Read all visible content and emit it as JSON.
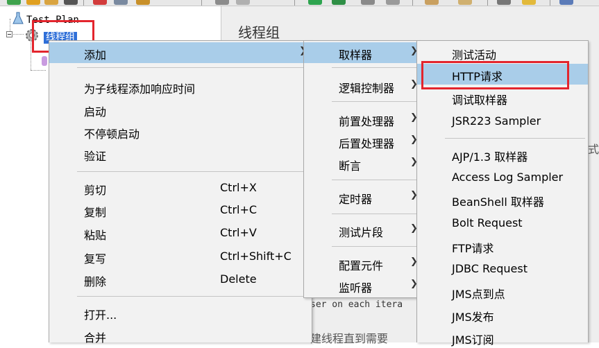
{
  "tree": {
    "root_label": "Test Plan",
    "thread_group_label": "线程组"
  },
  "right_panel": {
    "title": "线程组",
    "fragment_1": "ser on each itera",
    "fragment_2": "建线程直到需要",
    "fragment_3": "式"
  },
  "context_menu": {
    "add": "添加",
    "add_response_time": "为子线程添加响应时间",
    "start": "启动",
    "start_no_pause": "不停顿启动",
    "validate": "验证",
    "cut": "剪切",
    "cut_shortcut": "Ctrl+X",
    "copy": "复制",
    "copy_shortcut": "Ctrl+C",
    "paste": "粘贴",
    "paste_shortcut": "Ctrl+V",
    "duplicate": "复写",
    "duplicate_shortcut": "Ctrl+Shift+C",
    "delete": "删除",
    "delete_shortcut": "Delete",
    "open": "打开...",
    "merge": "合并"
  },
  "add_submenu": {
    "sampler": "取样器",
    "logic_controller": "逻辑控制器",
    "pre_processor": "前置处理器",
    "post_processor": "后置处理器",
    "assertion": "断言",
    "timer": "定时器",
    "test_fragment": "测试片段",
    "config_element": "配置元件",
    "listener": "监听器"
  },
  "sampler_submenu": {
    "items": [
      "测试活动",
      "HTTP请求",
      "调试取样器",
      "JSR223 Sampler",
      "AJP/1.3 取样器",
      "Access Log Sampler",
      "BeanShell 取样器",
      "Bolt Request",
      "FTP请求",
      "JDBC Request",
      "JMS点到点",
      "JMS发布",
      "JMS订阅"
    ]
  },
  "colors": {
    "highlight": "#a9cde9",
    "annotation_red": "#e3252d",
    "selection_blue": "#2f6fd8"
  }
}
